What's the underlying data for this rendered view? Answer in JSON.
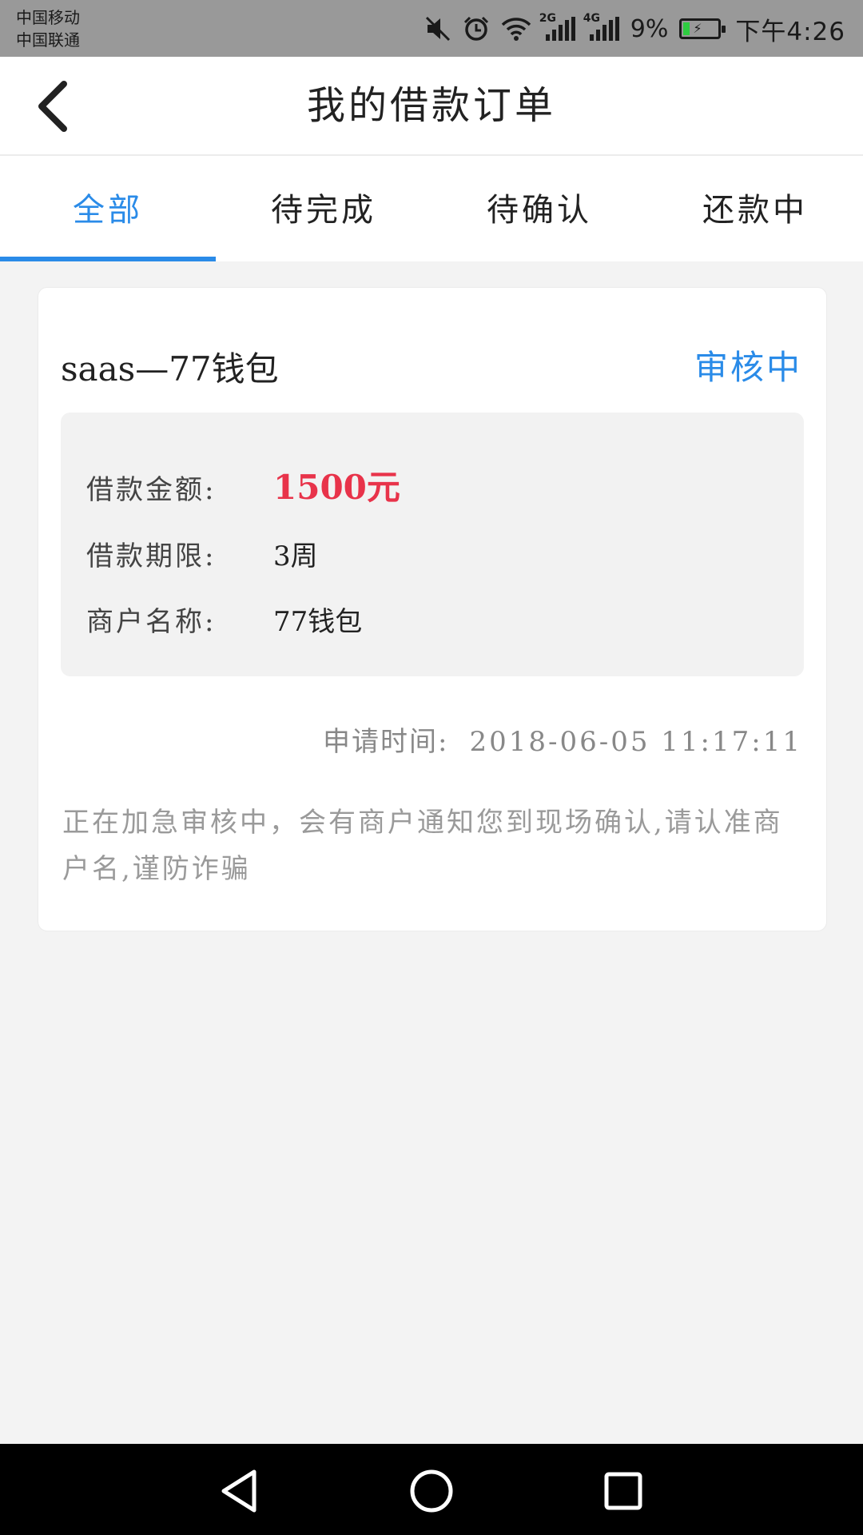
{
  "status_bar": {
    "carrier_1": "中国移动",
    "carrier_2": "中国联通",
    "net_1": "2G",
    "net_2": "4G",
    "battery_percent": "9%",
    "battery_level": 0.09,
    "time": "下午4:26",
    "icons": [
      "mute-icon",
      "alarm-icon",
      "wifi-icon",
      "signal-icon",
      "battery-icon"
    ]
  },
  "header": {
    "title": "我的借款订单",
    "back_icon": "chevron-left-icon"
  },
  "tabs": [
    {
      "label": "全部",
      "active": true
    },
    {
      "label": "待完成",
      "active": false
    },
    {
      "label": "待确认",
      "active": false
    },
    {
      "label": "还款中",
      "active": false
    }
  ],
  "order": {
    "merchant_title": "saas—77钱包",
    "status": "审核中",
    "amount_label": "借款金额:",
    "amount_value": "1500元",
    "term_label": "借款期限:",
    "term_value": "3周",
    "merchant_label": "商户名称:",
    "merchant_value": "77钱包",
    "apply_time_label": "申请时间:",
    "apply_time_value": "2018-06-05 11:17:11",
    "notice": "正在加急审核中，会有商户通知您到现场确认,请认准商户名,谨防诈骗"
  },
  "nav_bar": {
    "icons": [
      "back-triangle-icon",
      "home-circle-icon",
      "recents-square-icon"
    ]
  },
  "colors": {
    "accent": "#2a8be8",
    "amount": "#e8334a",
    "status_bar": "#999999",
    "page_bg": "#f3f3f3"
  }
}
